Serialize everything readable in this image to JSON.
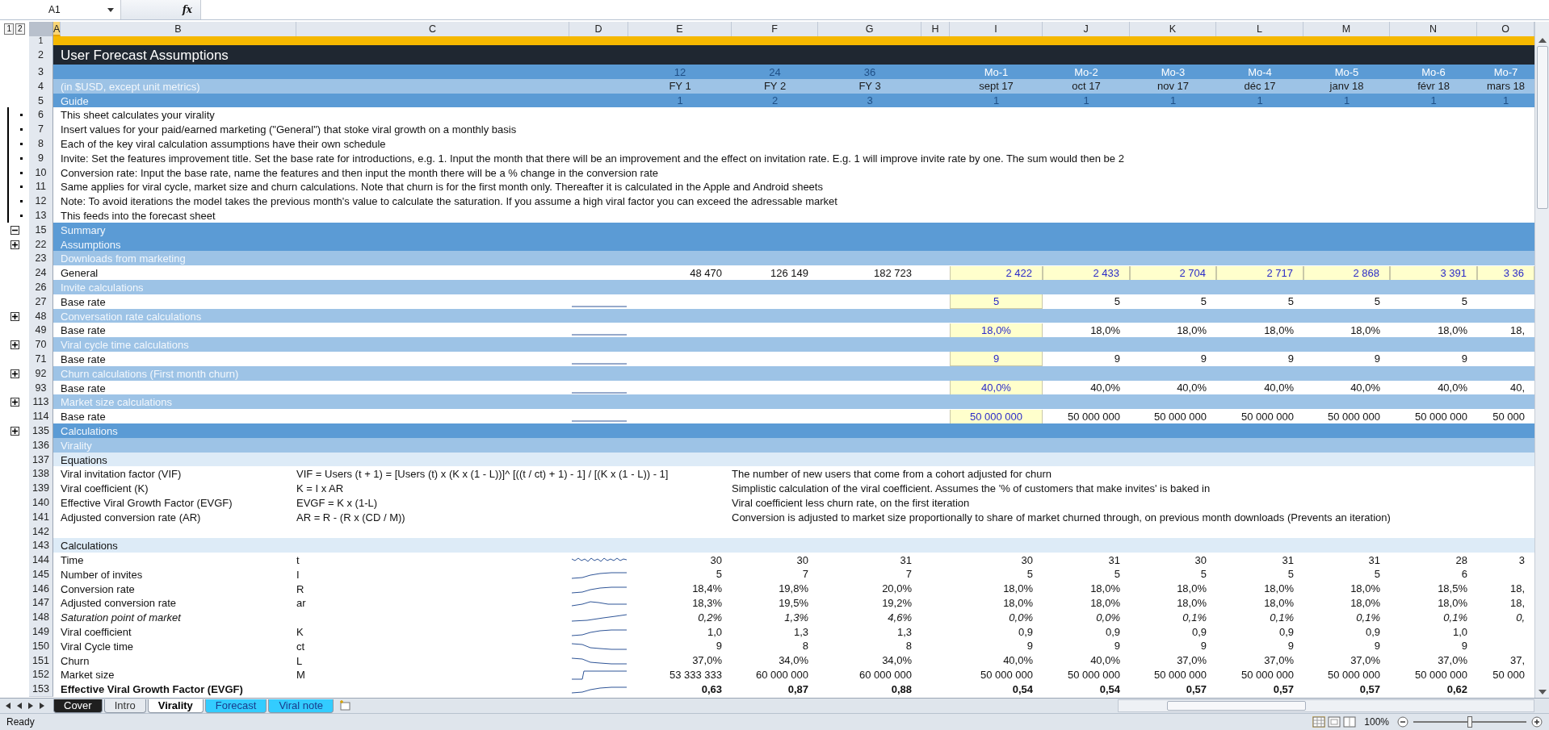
{
  "formula_bar": {
    "name_box": "A1",
    "function_label": "fx"
  },
  "outline_levels": [
    "1",
    "2"
  ],
  "columns": [
    {
      "label": "A",
      "selected": true
    },
    {
      "label": "B",
      "selected": false
    },
    {
      "label": "C",
      "selected": false
    },
    {
      "label": "D",
      "selected": false
    },
    {
      "label": "E",
      "selected": false
    },
    {
      "label": "F",
      "selected": false
    },
    {
      "label": "G",
      "selected": false
    },
    {
      "label": "H",
      "selected": false
    },
    {
      "label": "I",
      "selected": false
    },
    {
      "label": "J",
      "selected": false
    },
    {
      "label": "K",
      "selected": false
    },
    {
      "label": "L",
      "selected": false
    },
    {
      "label": "M",
      "selected": false
    },
    {
      "label": "N",
      "selected": false
    },
    {
      "label": "O",
      "selected": false
    }
  ],
  "rows": [
    {
      "num": "1",
      "kind": "accent"
    },
    {
      "num": "2",
      "kind": "title",
      "label": "User Forecast Assumptions"
    },
    {
      "num": "3",
      "kind": "band",
      "cells": {
        "E": {
          "text": "12",
          "faint": true
        },
        "F": {
          "text": "24",
          "faint": true
        },
        "G": {
          "text": "36",
          "faint": true
        },
        "I": {
          "text": "Mo-1"
        },
        "J": {
          "text": "Mo-2"
        },
        "K": {
          "text": "Mo-3"
        },
        "L": {
          "text": "Mo-4"
        },
        "M": {
          "text": "Mo-5"
        },
        "N": {
          "text": "Mo-6"
        },
        "O": {
          "text": "Mo-7"
        }
      }
    },
    {
      "num": "4",
      "kind": "subband",
      "label": "(in $USD, except unit metrics)",
      "cells": {
        "E": {
          "text": "FY 1"
        },
        "F": {
          "text": "FY 2"
        },
        "G": {
          "text": "FY 3"
        },
        "I": {
          "text": "sept 17"
        },
        "J": {
          "text": "oct 17"
        },
        "K": {
          "text": "nov 17"
        },
        "L": {
          "text": "déc 17"
        },
        "M": {
          "text": "janv 18"
        },
        "N": {
          "text": "févr 18"
        },
        "O": {
          "text": "mars 18"
        }
      }
    },
    {
      "num": "5",
      "kind": "band",
      "label": "Guide",
      "cells": {
        "E": {
          "text": "1",
          "faint": true
        },
        "F": {
          "text": "2",
          "faint": true
        },
        "G": {
          "text": "3",
          "faint": true
        },
        "I": {
          "text": "1",
          "faint": true
        },
        "J": {
          "text": "1",
          "faint": true
        },
        "K": {
          "text": "1",
          "faint": true
        },
        "L": {
          "text": "1",
          "faint": true
        },
        "M": {
          "text": "1",
          "faint": true
        },
        "N": {
          "text": "1",
          "faint": true
        },
        "O": {
          "text": "1",
          "faint": true
        }
      }
    },
    {
      "num": "6",
      "kind": "text",
      "grouped": true,
      "label": "This sheet calculates your virality"
    },
    {
      "num": "7",
      "kind": "text",
      "grouped": true,
      "label": "Insert values for your paid/earned marketing (\"General\") that stoke viral growth on a monthly basis"
    },
    {
      "num": "8",
      "kind": "text",
      "grouped": true,
      "label": "Each of the key viral calculation assumptions have their own schedule"
    },
    {
      "num": "9",
      "kind": "text",
      "grouped": true,
      "label": "Invite: Set the features improvement title. Set the base rate for introductions, e.g. 1. Input the month that there will be an improvement and the effect on invitation rate. E.g. 1 will improve invite rate by one. The sum would then be 2"
    },
    {
      "num": "10",
      "kind": "text",
      "grouped": true,
      "label": "Conversion rate: Input the base rate, name the features and then input the month there will be a % change in the conversion rate"
    },
    {
      "num": "11",
      "kind": "text",
      "grouped": true,
      "label": "Same applies for viral cycle, market size and churn calculations. Note that churn is for the first month only. Thereafter it is calculated in the Apple and Android sheets"
    },
    {
      "num": "12",
      "kind": "text",
      "grouped": true,
      "label": "Note: To avoid iterations the model takes the previous month's value to calculate the saturation. If you assume a high viral factor you can exceed the adressable market"
    },
    {
      "num": "13",
      "kind": "text",
      "grouped": true,
      "label": "This feeds into the forecast sheet"
    },
    {
      "num": "15",
      "kind": "band",
      "expanded": true,
      "label": "Summary"
    },
    {
      "num": "22",
      "kind": "band",
      "expanded": false,
      "label": "Assumptions"
    },
    {
      "num": "23",
      "kind": "subband",
      "label": "Downloads from marketing"
    },
    {
      "num": "24",
      "kind": "data",
      "label": "General",
      "cells": {
        "E": {
          "text": "48 470"
        },
        "F": {
          "text": "126 149"
        },
        "G": {
          "text": "182 723"
        },
        "I": {
          "text": "2 422",
          "input": true
        },
        "J": {
          "text": "2 433",
          "input": true
        },
        "K": {
          "text": "2 704",
          "input": true
        },
        "L": {
          "text": "2 717",
          "input": true
        },
        "M": {
          "text": "2 868",
          "input": true
        },
        "N": {
          "text": "3 391",
          "input": true
        },
        "O": {
          "text": "3 36",
          "input": true
        }
      }
    },
    {
      "num": "26",
      "kind": "subband",
      "label": "Invite calculations"
    },
    {
      "num": "27",
      "kind": "rate",
      "label": "Base rate",
      "sparkline": {
        "kind": "flat"
      },
      "cells": {
        "I": {
          "text": "5",
          "input": true
        },
        "J": {
          "text": "5"
        },
        "K": {
          "text": "5"
        },
        "L": {
          "text": "5"
        },
        "M": {
          "text": "5"
        },
        "N": {
          "text": "5"
        }
      }
    },
    {
      "num": "48",
      "kind": "subband",
      "expanded": false,
      "label": "Conversation rate calculations"
    },
    {
      "num": "49",
      "kind": "rate",
      "label": "Base rate",
      "sparkline": {
        "kind": "flat"
      },
      "cells": {
        "I": {
          "text": "18,0%",
          "input": true
        },
        "J": {
          "text": "18,0%"
        },
        "K": {
          "text": "18,0%"
        },
        "L": {
          "text": "18,0%"
        },
        "M": {
          "text": "18,0%"
        },
        "N": {
          "text": "18,0%"
        },
        "O": {
          "text": "18,"
        }
      }
    },
    {
      "num": "70",
      "kind": "subband",
      "expanded": false,
      "label": "Viral cycle time calculations"
    },
    {
      "num": "71",
      "kind": "rate",
      "label": "Base rate",
      "sparkline": {
        "kind": "flat"
      },
      "cells": {
        "I": {
          "text": "9",
          "input": true
        },
        "J": {
          "text": "9"
        },
        "K": {
          "text": "9"
        },
        "L": {
          "text": "9"
        },
        "M": {
          "text": "9"
        },
        "N": {
          "text": "9"
        }
      }
    },
    {
      "num": "92",
      "kind": "subband",
      "expanded": false,
      "label": "Churn calculations (First month churn)"
    },
    {
      "num": "93",
      "kind": "rate",
      "label": "Base rate",
      "sparkline": {
        "kind": "flat"
      },
      "cells": {
        "I": {
          "text": "40,0%",
          "input": true
        },
        "J": {
          "text": "40,0%"
        },
        "K": {
          "text": "40,0%"
        },
        "L": {
          "text": "40,0%"
        },
        "M": {
          "text": "40,0%"
        },
        "N": {
          "text": "40,0%"
        },
        "O": {
          "text": "40,"
        }
      }
    },
    {
      "num": "113",
      "kind": "subband",
      "expanded": false,
      "label": "Market size calculations"
    },
    {
      "num": "114",
      "kind": "rate",
      "label": "Base rate",
      "sparkline": {
        "kind": "flat"
      },
      "cells": {
        "I": {
          "text": "50 000 000",
          "input": true
        },
        "J": {
          "text": "50 000 000"
        },
        "K": {
          "text": "50 000 000"
        },
        "L": {
          "text": "50 000 000"
        },
        "M": {
          "text": "50 000 000"
        },
        "N": {
          "text": "50 000 000"
        },
        "O": {
          "text": "50 000"
        }
      }
    },
    {
      "num": "135",
      "kind": "band",
      "expanded": false,
      "label": "Calculations"
    },
    {
      "num": "136",
      "kind": "subband",
      "label": "Virality"
    },
    {
      "num": "137",
      "kind": "pale",
      "label": "Equations"
    },
    {
      "num": "138",
      "kind": "equation",
      "label": "Viral invitation factor (VIF)",
      "formula": "VIF = Users (t + 1) = [Users  (t) x (K x (1 - L))]^ [((t / ct) + 1) - 1] / [(K x (1 - L)) - 1]",
      "note": "The number of new users that come from a cohort adjusted for churn"
    },
    {
      "num": "139",
      "kind": "equation",
      "label": "Viral coefficient (K)",
      "formula": "K = I x AR",
      "note": "Simplistic calculation of the viral coefficient. Assumes the '% of customers that make invites' is baked in"
    },
    {
      "num": "140",
      "kind": "equation",
      "label": "Effective Viral Growth Factor (EVGF)",
      "formula": "EVGF = K x (1-L)",
      "note": "Viral coefficient less churn rate, on the first iteration"
    },
    {
      "num": "141",
      "kind": "equation",
      "label": "Adjusted conversion rate (AR)",
      "formula": "AR = R - (R x (CD / M))",
      "note": "Conversion is adjusted to market size proportionally to share of market churned through, on previous month downloads (Prevents an iteration)"
    },
    {
      "num": "142",
      "kind": "text"
    },
    {
      "num": "143",
      "kind": "pale",
      "label": "Calculations"
    },
    {
      "num": "144",
      "kind": "calc",
      "label": "Time",
      "symbol": "t",
      "sparkline": {
        "kind": "wavy"
      },
      "cells": {
        "E": {
          "text": "30"
        },
        "F": {
          "text": "30"
        },
        "G": {
          "text": "31"
        },
        "I": {
          "text": "30"
        },
        "J": {
          "text": "31"
        },
        "K": {
          "text": "30"
        },
        "L": {
          "text": "31"
        },
        "M": {
          "text": "31"
        },
        "N": {
          "text": "28"
        },
        "O": {
          "text": "3"
        }
      }
    },
    {
      "num": "145",
      "kind": "calc",
      "label": "Number of invites",
      "symbol": "I",
      "sparkline": {
        "kind": "rise"
      },
      "cells": {
        "E": {
          "text": "5"
        },
        "F": {
          "text": "7"
        },
        "G": {
          "text": "7"
        },
        "I": {
          "text": "5"
        },
        "J": {
          "text": "5"
        },
        "K": {
          "text": "5"
        },
        "L": {
          "text": "5"
        },
        "M": {
          "text": "5"
        },
        "N": {
          "text": "6"
        }
      }
    },
    {
      "num": "146",
      "kind": "calc",
      "label": "Conversion rate",
      "symbol": "R",
      "sparkline": {
        "kind": "rise"
      },
      "cells": {
        "E": {
          "text": "18,4%"
        },
        "F": {
          "text": "19,8%"
        },
        "G": {
          "text": "20,0%"
        },
        "I": {
          "text": "18,0%"
        },
        "J": {
          "text": "18,0%"
        },
        "K": {
          "text": "18,0%"
        },
        "L": {
          "text": "18,0%"
        },
        "M": {
          "text": "18,0%"
        },
        "N": {
          "text": "18,5%"
        },
        "O": {
          "text": "18,"
        }
      }
    },
    {
      "num": "147",
      "kind": "calc",
      "label": "Adjusted conversion rate",
      "symbol": "ar",
      "sparkline": {
        "kind": "bump"
      },
      "cells": {
        "E": {
          "text": "18,3%"
        },
        "F": {
          "text": "19,5%"
        },
        "G": {
          "text": "19,2%"
        },
        "I": {
          "text": "18,0%"
        },
        "J": {
          "text": "18,0%"
        },
        "K": {
          "text": "18,0%"
        },
        "L": {
          "text": "18,0%"
        },
        "M": {
          "text": "18,0%"
        },
        "N": {
          "text": "18,0%"
        },
        "O": {
          "text": "18,"
        }
      }
    },
    {
      "num": "148",
      "kind": "calc",
      "italic": true,
      "label": "Saturation point of market",
      "sparkline": {
        "kind": "ramp"
      },
      "cells": {
        "E": {
          "text": "0,2%"
        },
        "F": {
          "text": "1,3%"
        },
        "G": {
          "text": "4,6%"
        },
        "I": {
          "text": "0,0%"
        },
        "J": {
          "text": "0,0%"
        },
        "K": {
          "text": "0,1%"
        },
        "L": {
          "text": "0,1%"
        },
        "M": {
          "text": "0,1%"
        },
        "N": {
          "text": "0,1%"
        },
        "O": {
          "text": "0,"
        }
      }
    },
    {
      "num": "149",
      "kind": "calc",
      "label": "Viral coefficient",
      "symbol": "K",
      "sparkline": {
        "kind": "rise"
      },
      "cells": {
        "E": {
          "text": "1,0"
        },
        "F": {
          "text": "1,3"
        },
        "G": {
          "text": "1,3"
        },
        "I": {
          "text": "0,9"
        },
        "J": {
          "text": "0,9"
        },
        "K": {
          "text": "0,9"
        },
        "L": {
          "text": "0,9"
        },
        "M": {
          "text": "0,9"
        },
        "N": {
          "text": "1,0"
        }
      }
    },
    {
      "num": "150",
      "kind": "calc",
      "label": "Viral Cycle time",
      "symbol": "ct",
      "sparkline": {
        "kind": "fall"
      },
      "cells": {
        "E": {
          "text": "9"
        },
        "F": {
          "text": "8"
        },
        "G": {
          "text": "8"
        },
        "I": {
          "text": "9"
        },
        "J": {
          "text": "9"
        },
        "K": {
          "text": "9"
        },
        "L": {
          "text": "9"
        },
        "M": {
          "text": "9"
        },
        "N": {
          "text": "9"
        }
      }
    },
    {
      "num": "151",
      "kind": "calc",
      "label": "Churn",
      "symbol": "L",
      "sparkline": {
        "kind": "fall"
      },
      "cells": {
        "E": {
          "text": "37,0%"
        },
        "F": {
          "text": "34,0%"
        },
        "G": {
          "text": "34,0%"
        },
        "I": {
          "text": "40,0%"
        },
        "J": {
          "text": "40,0%"
        },
        "K": {
          "text": "37,0%"
        },
        "L": {
          "text": "37,0%"
        },
        "M": {
          "text": "37,0%"
        },
        "N": {
          "text": "37,0%"
        },
        "O": {
          "text": "37,"
        }
      }
    },
    {
      "num": "152",
      "kind": "calc",
      "label": "Market size",
      "symbol": "M",
      "sparkline": {
        "kind": "step"
      },
      "cells": {
        "E": {
          "text": "53 333 333"
        },
        "F": {
          "text": "60 000 000"
        },
        "G": {
          "text": "60 000 000"
        },
        "I": {
          "text": "50 000 000"
        },
        "J": {
          "text": "50 000 000"
        },
        "K": {
          "text": "50 000 000"
        },
        "L": {
          "text": "50 000 000"
        },
        "M": {
          "text": "50 000 000"
        },
        "N": {
          "text": "50 000 000"
        },
        "O": {
          "text": "50 000"
        }
      }
    },
    {
      "num": "153",
      "kind": "calc",
      "bold": true,
      "label": "Effective Viral Growth Factor (EVGF)",
      "sparkline": {
        "kind": "rise"
      },
      "cells": {
        "E": {
          "text": "0,63"
        },
        "F": {
          "text": "0,87"
        },
        "G": {
          "text": "0,88"
        },
        "I": {
          "text": "0,54"
        },
        "J": {
          "text": "0,54"
        },
        "K": {
          "text": "0,57"
        },
        "L": {
          "text": "0,57"
        },
        "M": {
          "text": "0,57"
        },
        "N": {
          "text": "0,62"
        }
      }
    }
  ],
  "sheet_tabs": [
    {
      "label": "Cover",
      "selected": false,
      "color": "#1f1f1f"
    },
    {
      "label": "Intro",
      "selected": false
    },
    {
      "label": "Virality",
      "selected": true
    },
    {
      "label": "Forecast",
      "selected": false,
      "color": "#33ccff"
    },
    {
      "label": "Viral note",
      "selected": false,
      "color": "#33ccff"
    }
  ],
  "status_bar": {
    "status": "Ready",
    "zoom": "100%",
    "zoom_slider": {
      "level": 0.5
    }
  }
}
